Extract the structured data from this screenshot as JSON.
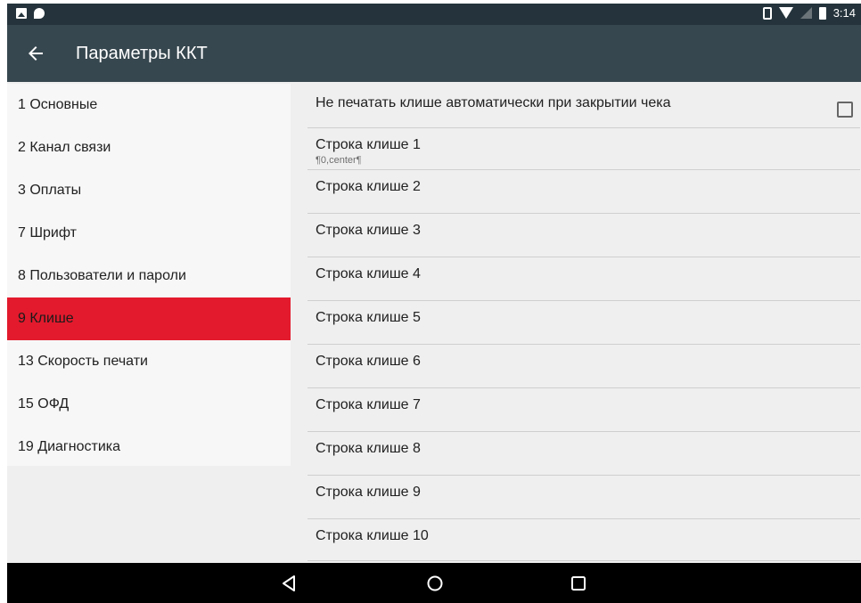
{
  "status_bar": {
    "time": "3:14",
    "icons": [
      "image-notification-icon",
      "chat-notification-icon",
      "vibrate-icon",
      "wifi-icon",
      "signal-icon",
      "battery-icon"
    ]
  },
  "app_bar": {
    "title": "Параметры ККТ",
    "back_icon": "arrow-back-icon",
    "background": "#37474f"
  },
  "sidebar": {
    "active_color": "#e31a2d",
    "items": [
      {
        "label": "1 Основные",
        "active": false
      },
      {
        "label": "2 Канал связи",
        "active": false
      },
      {
        "label": "3 Оплаты",
        "active": false
      },
      {
        "label": "7 Шрифт",
        "active": false
      },
      {
        "label": "8 Пользователи и пароли",
        "active": false
      },
      {
        "label": "9 Клише",
        "active": true
      },
      {
        "label": "13 Скорость печати",
        "active": false
      },
      {
        "label": "15 ОФД",
        "active": false
      },
      {
        "label": "19 Диагностика",
        "active": false
      }
    ]
  },
  "content": {
    "toggle": {
      "label": "Не печатать клише автоматически при закрытии чека",
      "checked": false
    },
    "rows": [
      {
        "title": "Строка клише 1",
        "subtitle": "¶0,center¶"
      },
      {
        "title": "Строка клише 2"
      },
      {
        "title": "Строка клише 3"
      },
      {
        "title": "Строка клише 4"
      },
      {
        "title": "Строка клише 5"
      },
      {
        "title": "Строка клише 6"
      },
      {
        "title": "Строка клише 7"
      },
      {
        "title": "Строка клише 8"
      },
      {
        "title": "Строка клише 9"
      },
      {
        "title": "Строка клише 10"
      }
    ]
  },
  "nav_bar": {
    "buttons": [
      "back-triangle-icon",
      "home-circle-icon",
      "recents-square-icon"
    ]
  }
}
